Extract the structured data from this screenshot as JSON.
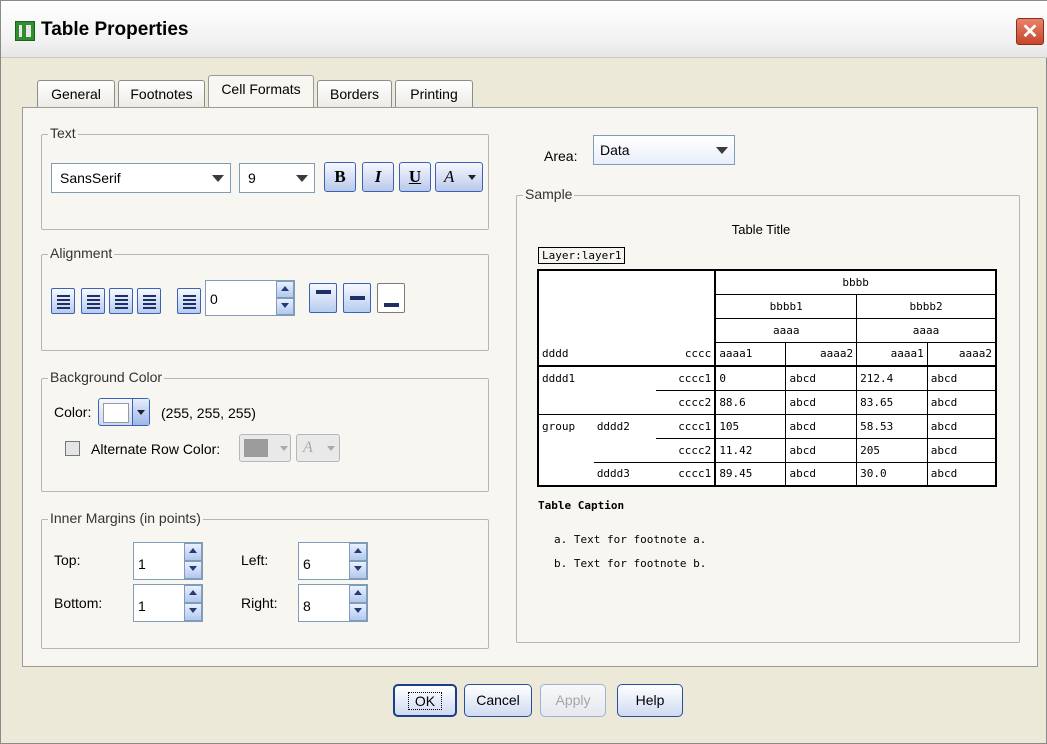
{
  "window": {
    "title": "Table Properties",
    "close_glyph": "✕"
  },
  "tabs": [
    {
      "label": "General"
    },
    {
      "label": "Footnotes"
    },
    {
      "label": "Cell Formats"
    },
    {
      "label": "Borders"
    },
    {
      "label": "Printing"
    }
  ],
  "active_tab": "Cell Formats",
  "text_group": {
    "label": "Text",
    "font": "SansSerif",
    "size": "9",
    "bold": "B",
    "italic": "I",
    "underline": "U",
    "color": "A"
  },
  "alignment_group": {
    "label": "Alignment",
    "indent": "0"
  },
  "background_group": {
    "label": "Background Color",
    "color_label": "Color:",
    "color_value": "(255, 255, 255)",
    "alternate_label": "Alternate Row Color:",
    "alternate_checked": false,
    "alternate_glyph": "A",
    "background_color": "#ffffff"
  },
  "margins_group": {
    "label": "Inner Margins (in points)",
    "top_label": "Top:",
    "top": "1",
    "bottom_label": "Bottom:",
    "bottom": "1",
    "left_label": "Left:",
    "left": "6",
    "right_label": "Right:",
    "right": "8"
  },
  "area": {
    "label": "Area:",
    "value": "Data"
  },
  "sample": {
    "label": "Sample",
    "table_title": "Table Title",
    "layer": "Layer:layer1",
    "caption": "Table Caption",
    "footnotes": [
      "a. Text for footnote a.",
      "b. Text for footnote b."
    ],
    "headers": {
      "top": "bbbb",
      "sub": [
        "bbbb1",
        "bbbb2"
      ],
      "aaaa": [
        "aaaa",
        "aaaa"
      ],
      "row_dim": "dddd",
      "col_dim": "cccc",
      "cols": [
        "aaaa1",
        "aaaa2",
        "aaaa1",
        "aaaa2"
      ]
    },
    "rows": [
      {
        "g": "dddd1",
        "d": "",
        "c": "cccc1",
        "v": [
          "0",
          "abcd",
          "212.4",
          "abcd"
        ]
      },
      {
        "g": "",
        "d": "",
        "c": "cccc2",
        "v": [
          "88.6",
          "abcd",
          "83.65",
          "abcd"
        ]
      },
      {
        "g": "group",
        "d": "dddd2",
        "c": "cccc1",
        "v": [
          "105",
          "abcd",
          "58.53",
          "abcd"
        ]
      },
      {
        "g": "",
        "d": "",
        "c": "cccc2",
        "v": [
          "11.42",
          "abcd",
          "205",
          "abcd"
        ]
      },
      {
        "g": "",
        "d": "dddd3",
        "c": "cccc1",
        "v": [
          "89.45",
          "abcd",
          "30.0",
          "abcd"
        ]
      }
    ]
  },
  "buttons": {
    "ok": "OK",
    "cancel": "Cancel",
    "apply": "Apply",
    "help": "Help"
  }
}
